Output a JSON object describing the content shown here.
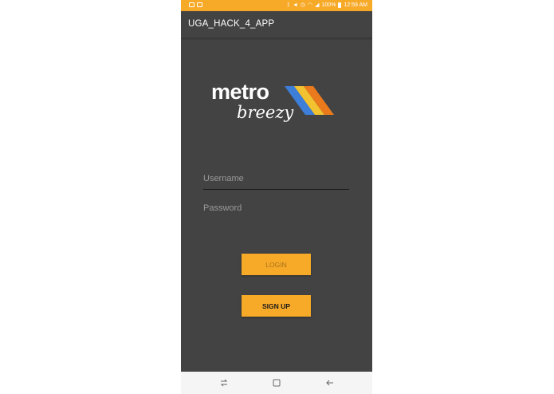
{
  "status_bar": {
    "battery": "100%",
    "time": "12:59 AM",
    "icons": [
      "notification-icon",
      "message-icon",
      "bluetooth-icon",
      "mute-icon",
      "alarm-icon",
      "wifi-icon",
      "signal-icon",
      "battery-icon"
    ]
  },
  "app_bar": {
    "title": "UGA_HACK_4_APP"
  },
  "logo": {
    "line1": "metro",
    "line2": "breezy",
    "stripe_colors": [
      "#3d7ed9",
      "#f2c230",
      "#ea7a1c"
    ]
  },
  "form": {
    "username_placeholder": "Username",
    "password_placeholder": "Password"
  },
  "buttons": {
    "login": "LOGIN",
    "signup": "SIGN UP"
  },
  "nav_bar": {
    "icons": [
      "recent-apps-icon",
      "home-icon",
      "back-icon"
    ]
  },
  "colors": {
    "accent": "#f7a928",
    "background": "#434343",
    "nav_background": "#f5f5f5"
  }
}
